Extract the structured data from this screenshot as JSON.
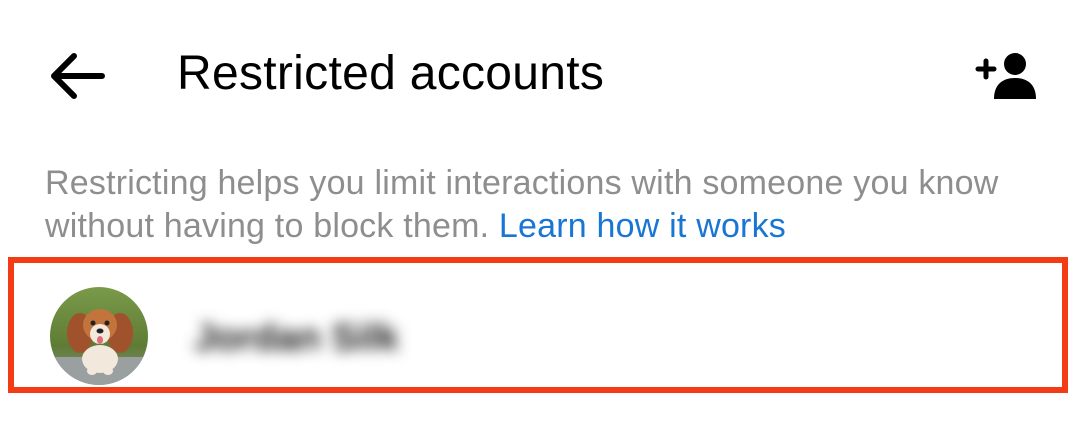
{
  "header": {
    "back_icon": "arrow-left-icon",
    "title": "Restricted accounts",
    "add_icon": "add-person-icon"
  },
  "description": {
    "text": "Restricting helps you limit interactions with someone you know without having to block them.",
    "link_label": "Learn how it works",
    "link_color": "#1976d2"
  },
  "accounts": [
    {
      "name": "Jordan Silk",
      "avatar_icon": "dog-avatar-icon"
    }
  ],
  "colors": {
    "highlight_border": "#f33b16",
    "text_primary": "#000000",
    "text_secondary": "#8e8e8e"
  }
}
